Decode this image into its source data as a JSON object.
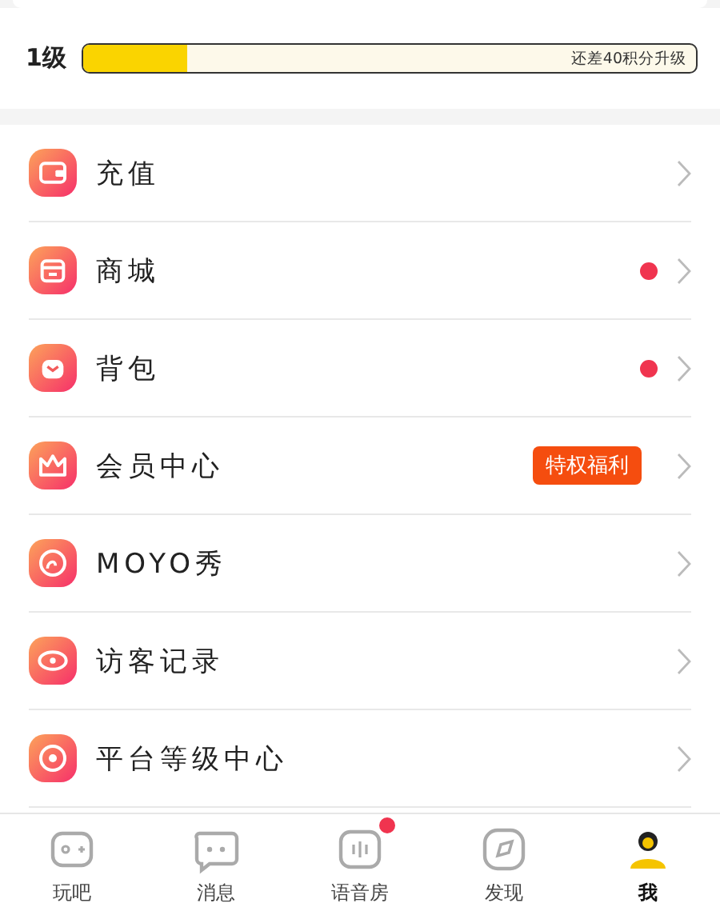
{
  "level": {
    "label": "1级",
    "level": 0.17,
    "hint": "还差40积分升级"
  },
  "menu": [
    {
      "label": "充值",
      "dot": false
    },
    {
      "label": "商城",
      "dot": true
    },
    {
      "label": "背包",
      "dot": true
    },
    {
      "label": "会员中心",
      "dot": false,
      "badge": "特权福利"
    },
    {
      "label": "MOYO秀",
      "dot": false
    },
    {
      "label": "访客记录",
      "dot": false
    },
    {
      "label": "平台等级中心",
      "dot": false
    }
  ],
  "tabbar": [
    {
      "label": "玩吧",
      "selected": false,
      "dot": false
    },
    {
      "label": "消息",
      "selected": false,
      "dot": false
    },
    {
      "label": "语音房",
      "selected": false,
      "dot": true
    },
    {
      "label": "发现",
      "selected": false,
      "dot": false
    },
    {
      "label": "我",
      "selected": true,
      "dot": false
    }
  ]
}
